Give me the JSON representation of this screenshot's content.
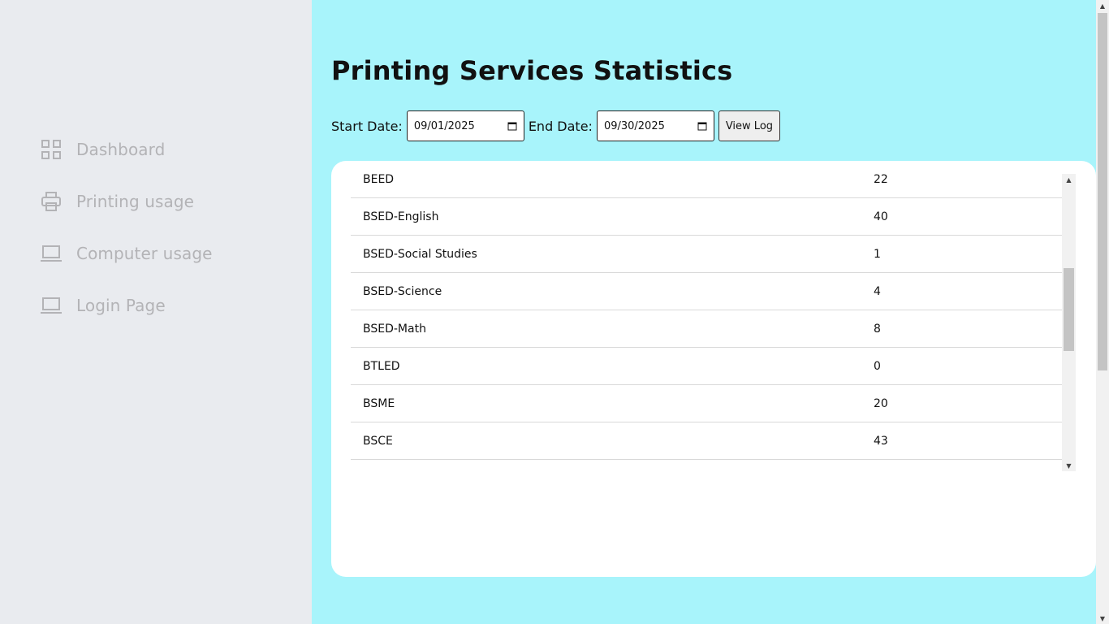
{
  "sidebar": {
    "items": [
      {
        "label": "Dashboard",
        "icon": "grid-icon"
      },
      {
        "label": "Printing usage",
        "icon": "printer-icon"
      },
      {
        "label": "Computer usage",
        "icon": "laptop-icon"
      },
      {
        "label": "Login Page",
        "icon": "laptop-icon"
      }
    ]
  },
  "main": {
    "title": "Printing Services Statistics",
    "filters": {
      "start_label": "Start Date:",
      "start_value": "09/01/2025",
      "end_label": "End Date:",
      "end_value": "09/30/2025",
      "view_label": "View Log"
    },
    "table": {
      "rows": [
        {
          "program": "BEED",
          "count": "22"
        },
        {
          "program": "BSED-English",
          "count": "40"
        },
        {
          "program": "BSED-Social Studies",
          "count": "1"
        },
        {
          "program": "BSED-Science",
          "count": "4"
        },
        {
          "program": "BSED-Math",
          "count": "8"
        },
        {
          "program": "BTLED",
          "count": "0"
        },
        {
          "program": "BSME",
          "count": "20"
        },
        {
          "program": "BSCE",
          "count": "43"
        }
      ]
    }
  },
  "colors": {
    "sidebar_bg": "#e9ebef",
    "main_bg": "#a8f4fb",
    "nav_text": "#b3b3b6",
    "card_bg": "#ffffff"
  }
}
